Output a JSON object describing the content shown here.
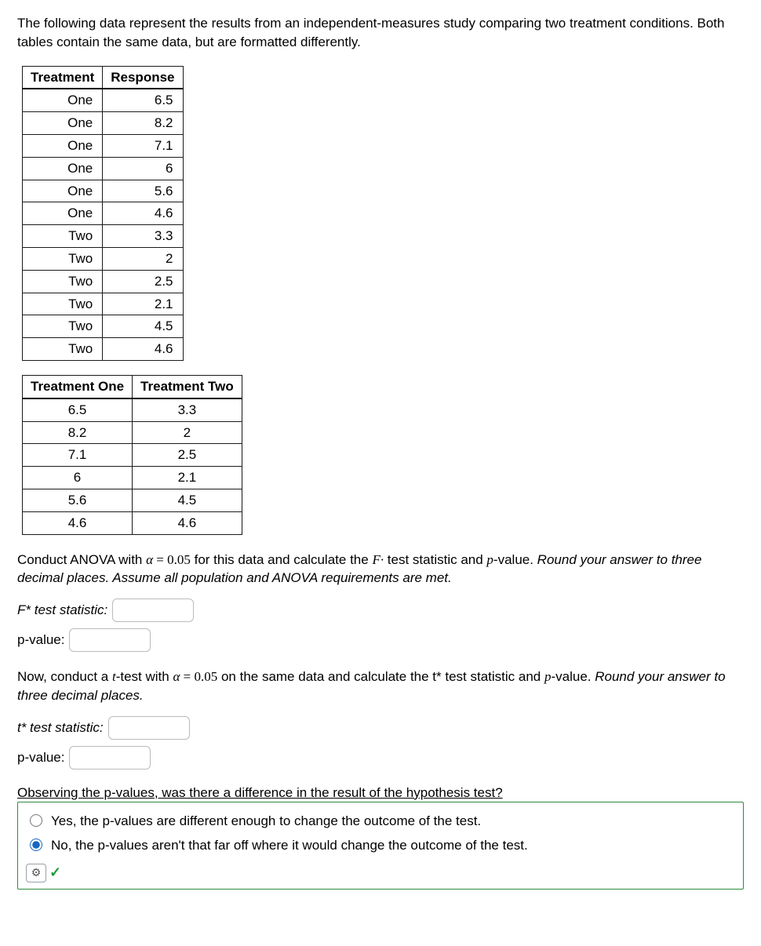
{
  "intro": "The following data represent the results from an independent-measures study comparing two treatment conditions. Both tables contain the same data, but are formatted differently.",
  "table1": {
    "headers": [
      "Treatment",
      "Response"
    ],
    "rows": [
      [
        "One",
        "6.5"
      ],
      [
        "One",
        "8.2"
      ],
      [
        "One",
        "7.1"
      ],
      [
        "One",
        "6"
      ],
      [
        "One",
        "5.6"
      ],
      [
        "One",
        "4.6"
      ],
      [
        "Two",
        "3.3"
      ],
      [
        "Two",
        "2"
      ],
      [
        "Two",
        "2.5"
      ],
      [
        "Two",
        "2.1"
      ],
      [
        "Two",
        "4.5"
      ],
      [
        "Two",
        "4.6"
      ]
    ]
  },
  "table2": {
    "headers": [
      "Treatment One",
      "Treatment Two"
    ],
    "rows": [
      [
        "6.5",
        "3.3"
      ],
      [
        "8.2",
        "2"
      ],
      [
        "7.1",
        "2.5"
      ],
      [
        "6",
        "2.1"
      ],
      [
        "5.6",
        "4.5"
      ],
      [
        "4.6",
        "4.6"
      ]
    ]
  },
  "anova_instruction": {
    "prefix": "Conduct ANOVA with ",
    "alpha_sym": "α",
    "alpha_eq": " = 0.05",
    "mid": " for this data and calculate the ",
    "Fdot": "F·",
    "mid2": " test statistic and ",
    "pvar": "p",
    "mid3": "-value. ",
    "italic": "Round your answer to three decimal places. Assume all population and ANOVA requirements are met."
  },
  "labels": {
    "f_stat": "F* test statistic:",
    "p_value": "p-value:",
    "t_stat": "t* test statistic:"
  },
  "ttest_instruction": {
    "prefix": "Now, conduct a ",
    "tvar": "t",
    "mid0": "-test with ",
    "alpha_sym": "α",
    "alpha_eq": " = 0.05",
    "mid": " on the same data and calculate the t* test statistic and ",
    "pvar": "p",
    "mid2": "-value. ",
    "italic": "Round your answer to three decimal places."
  },
  "mc": {
    "header": "Observing the p-values, was there a difference in the result of the hypothesis test?",
    "options": [
      "Yes, the p-values are different enough to change the outcome of the test.",
      "No, the p-values aren't that far off where it would change the outcome of the test."
    ],
    "selected_index": 1
  },
  "icons": {
    "gear": "⚙",
    "check": "✓"
  }
}
